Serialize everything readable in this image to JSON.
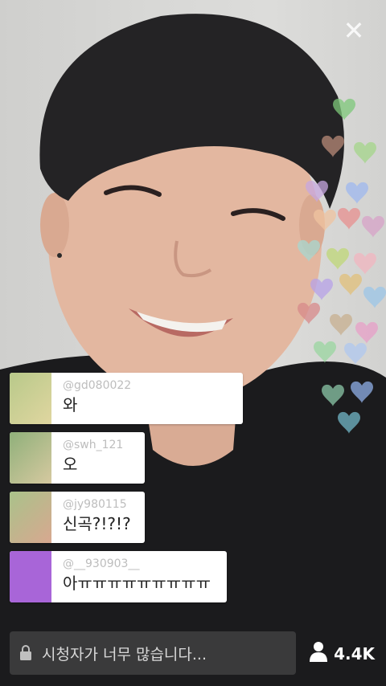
{
  "colors": {
    "accent_purple": "#a865d8",
    "input_bg": "#464646"
  },
  "icons": {
    "close": "close-icon",
    "lock": "lock-icon",
    "viewer": "person-icon",
    "hearts": "heart-icon"
  },
  "comments": [
    {
      "user": "@gd080022",
      "msg": "와"
    },
    {
      "user": "@swh_121",
      "msg": "오"
    },
    {
      "user": "@jy980115",
      "msg": "신곡?!?!?"
    },
    {
      "user": "@__930903__",
      "msg": "아ㅠㅠㅠㅠㅠㅠㅠㅠㅠ"
    }
  ],
  "input": {
    "placeholder": "시청자가 너무 많습니다..."
  },
  "viewers": {
    "count": "4.4K"
  }
}
